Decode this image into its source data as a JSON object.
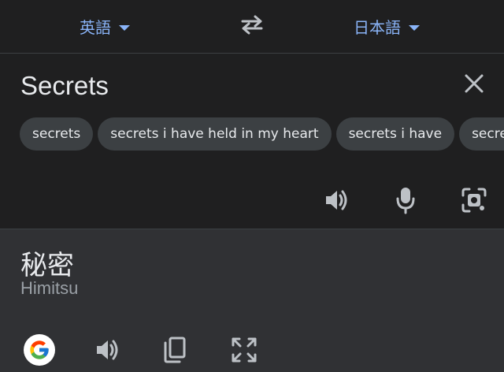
{
  "header": {
    "source_language": "英語",
    "target_language": "日本語",
    "swap_icon": "swap-icon"
  },
  "input": {
    "text": "Secrets",
    "clear_icon": "close-icon",
    "suggestions": [
      "secrets",
      "secrets i have held in my heart",
      "secrets i have",
      "secrets"
    ],
    "tools": [
      "speaker-icon",
      "microphone-icon",
      "camera-icon"
    ]
  },
  "output": {
    "translation": "秘密",
    "transliteration": "Himitsu",
    "tools": [
      "google-logo",
      "speaker-icon",
      "copy-icon",
      "fullscreen-icon"
    ]
  },
  "colors": {
    "accent": "#8ab4f8",
    "input_bg": "#1f1f20",
    "output_bg": "#303134",
    "chip_bg": "#3c4043",
    "icon": "#bdc1c6"
  }
}
